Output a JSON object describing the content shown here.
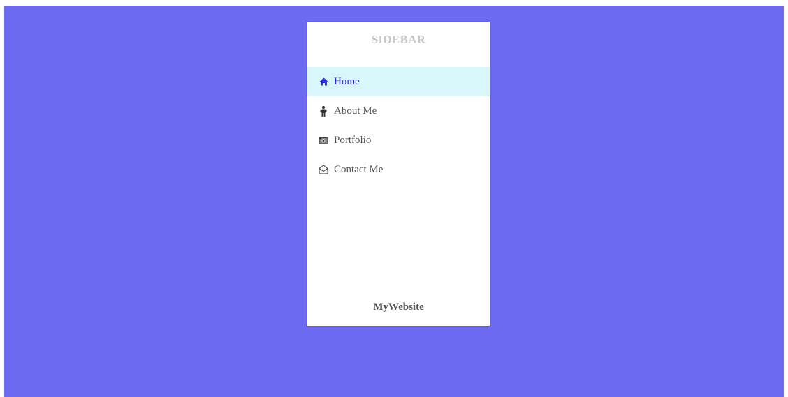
{
  "sidebar": {
    "title": "SIDEBAR",
    "items": [
      {
        "label": "Home",
        "icon": "home-icon",
        "active": true
      },
      {
        "label": "About Me",
        "icon": "person-icon",
        "active": false
      },
      {
        "label": "Portfolio",
        "icon": "camera-icon",
        "active": false
      },
      {
        "label": "Contact Me",
        "icon": "envelope-open-icon",
        "active": false
      }
    ],
    "footer": "MyWebsite"
  },
  "colors": {
    "background": "#6b6af0",
    "active_bg": "#d9f6fb",
    "active_text": "#2b28e6",
    "text": "#555555",
    "title": "#c8c8c8"
  }
}
